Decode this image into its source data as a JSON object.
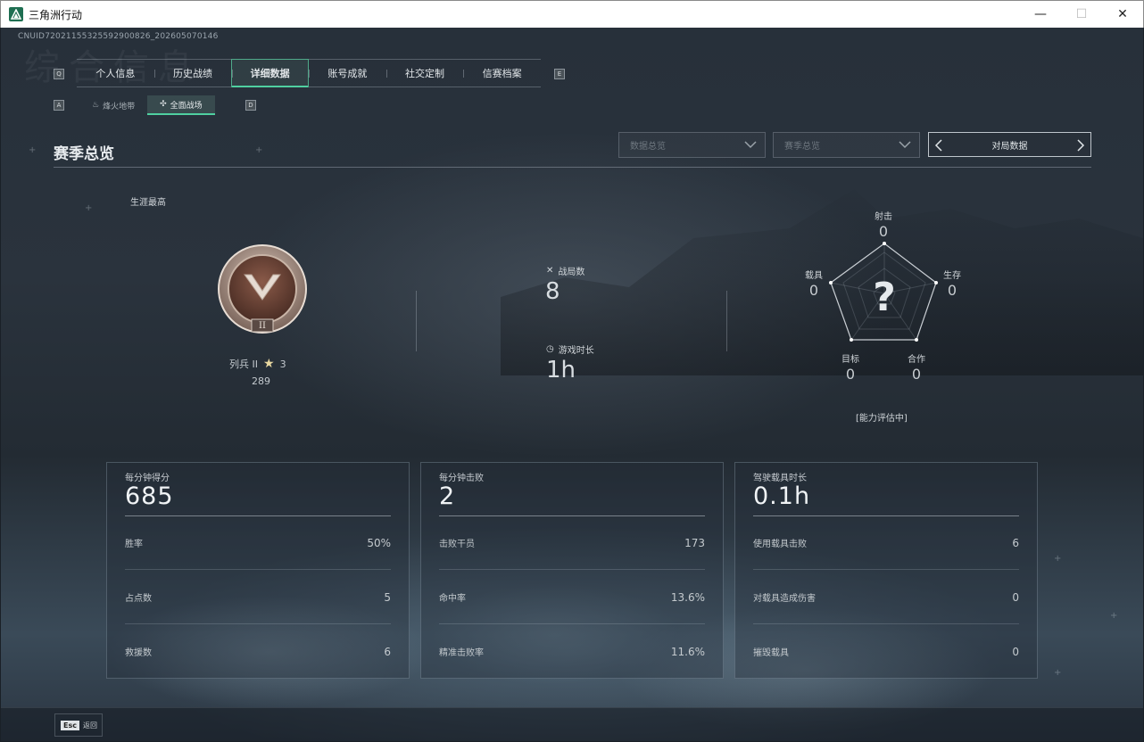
{
  "window": {
    "title": "三角洲行动",
    "minimize": "—",
    "maximize": "☐",
    "close": "✕"
  },
  "uid": "CNUID72021155325592900826_202605070146",
  "ghost_title": "综合信息",
  "tabs": {
    "left_key": "Q",
    "right_key": "E",
    "items": [
      {
        "label": "个人信息",
        "active": false
      },
      {
        "label": "历史战绩",
        "active": false
      },
      {
        "label": "详细数据",
        "active": true
      },
      {
        "label": "账号成就",
        "active": false
      },
      {
        "label": "社交定制",
        "active": false
      },
      {
        "label": "信赛档案",
        "active": false
      }
    ]
  },
  "subtabs": {
    "left_key": "A",
    "right_key": "D",
    "items": [
      {
        "label": "烽火地带",
        "active": false
      },
      {
        "label": "全面战场",
        "active": true
      }
    ]
  },
  "section": {
    "title": "赛季总览",
    "dropdown1": "数据总览",
    "dropdown2": "赛季总览",
    "pager_label": "对局数据"
  },
  "rank": {
    "career_label": "生涯最高",
    "name": "列兵 II",
    "stars": "3",
    "points": "289",
    "roman": "II"
  },
  "overview": {
    "matches_label": "战局数",
    "matches_value": "8",
    "playtime_label": "游戏时长",
    "playtime_value": "1h"
  },
  "radar": {
    "shooting_label": "射击",
    "shooting_value": "0",
    "survival_label": "生存",
    "survival_value": "0",
    "cooperation_label": "合作",
    "cooperation_value": "0",
    "objective_label": "目标",
    "objective_value": "0",
    "vehicle_label": "载具",
    "vehicle_value": "0",
    "status": "[能力评估中]"
  },
  "cards": [
    {
      "title": "每分钟得分",
      "value": "685",
      "rows": [
        {
          "label": "胜率",
          "value": "50%"
        },
        {
          "label": "占点数",
          "value": "5"
        },
        {
          "label": "救援数",
          "value": "6"
        }
      ]
    },
    {
      "title": "每分钟击败",
      "value": "2",
      "rows": [
        {
          "label": "击败干员",
          "value": "173"
        },
        {
          "label": "命中率",
          "value": "13.6%"
        },
        {
          "label": "精准击败率",
          "value": "11.6%"
        }
      ]
    },
    {
      "title": "驾驶载具时长",
      "value": "0.1h",
      "rows": [
        {
          "label": "使用载具击败",
          "value": "6"
        },
        {
          "label": "对载具造成伤害",
          "value": "0"
        },
        {
          "label": "摧毁载具",
          "value": "0"
        }
      ]
    }
  ],
  "bottom": {
    "esc_key": "Esc",
    "esc_label": "返回"
  }
}
